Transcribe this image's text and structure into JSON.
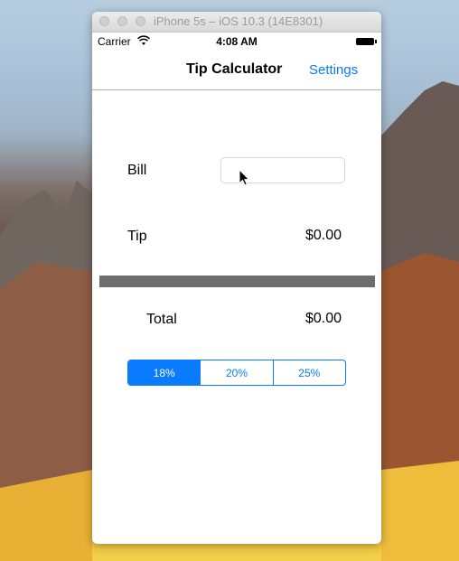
{
  "window": {
    "title": "iPhone 5s – iOS 10.3 (14E8301)"
  },
  "status_bar": {
    "carrier": "Carrier",
    "time": "4:08 AM"
  },
  "nav_bar": {
    "title": "Tip Calculator",
    "settings_label": "Settings"
  },
  "form": {
    "bill_label": "Bill",
    "bill_value": "",
    "tip_label": "Tip",
    "tip_value": "$0.00",
    "total_label": "Total",
    "total_value": "$0.00"
  },
  "tip_segments": {
    "options": [
      "18%",
      "20%",
      "25%"
    ],
    "selected_index": 0
  },
  "colors": {
    "accent": "#0a7aff",
    "divider": "#6e6e6e"
  }
}
